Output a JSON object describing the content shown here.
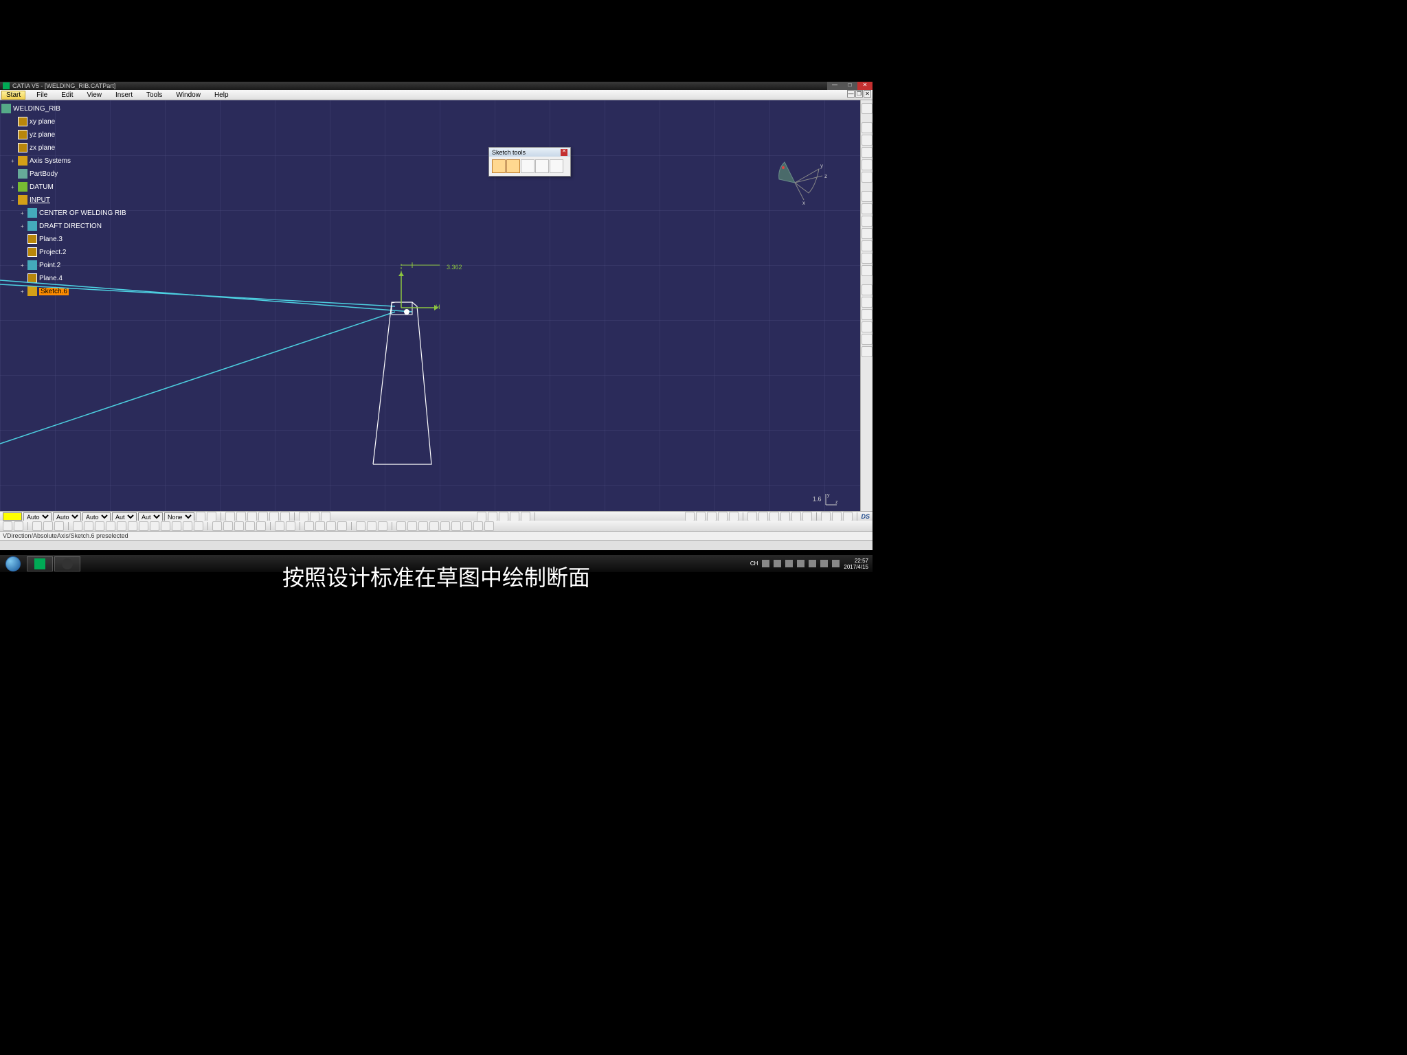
{
  "titlebar": {
    "title": "CATIA V5 - [WELDING_RIB.CATPart]"
  },
  "menubar": {
    "start": "Start",
    "items": [
      "File",
      "Edit",
      "View",
      "Insert",
      "Tools",
      "Window",
      "Help"
    ]
  },
  "tree": {
    "root": "WELDING_RIB",
    "items": [
      {
        "label": "xy plane",
        "indent": 1,
        "icon": "plane"
      },
      {
        "label": "yz plane",
        "indent": 1,
        "icon": "plane"
      },
      {
        "label": "zx plane",
        "indent": 1,
        "icon": "plane"
      },
      {
        "label": "Axis Systems",
        "indent": 1,
        "icon": "geo",
        "exp": "+"
      },
      {
        "label": "PartBody",
        "indent": 1,
        "icon": "part",
        "exp": ""
      },
      {
        "label": "DATUM",
        "indent": 1,
        "icon": "datum",
        "exp": "+"
      },
      {
        "label": "INPUT",
        "indent": 1,
        "icon": "input",
        "exp": "−",
        "underline": true
      },
      {
        "label": "CENTER OF WELDING RIB",
        "indent": 2,
        "icon": "center",
        "exp": "+"
      },
      {
        "label": "DRAFT DIRECTION",
        "indent": 2,
        "icon": "dir",
        "exp": "+"
      },
      {
        "label": "Plane.3",
        "indent": 2,
        "icon": "plane"
      },
      {
        "label": "Project.2",
        "indent": 2,
        "icon": "plane"
      },
      {
        "label": "Point.2",
        "indent": 2,
        "icon": "point",
        "exp": "+"
      },
      {
        "label": "Plane.4",
        "indent": 2,
        "icon": "plane"
      },
      {
        "label": "Sketch.6",
        "indent": 2,
        "icon": "sketch",
        "exp": "+",
        "selected": true
      }
    ]
  },
  "sketch_tools": {
    "title": "Sketch tools"
  },
  "dimension": "3.362",
  "axis_label": "H",
  "scale": "1.6",
  "status": "VDirection/AbsoluteAxis/Sketch.6 preselected",
  "bottom_selects": [
    "Auto",
    "Auto",
    "Auto",
    "Aut",
    "Aut",
    "None"
  ],
  "logo": "DS",
  "taskbar": {
    "lang": "CH",
    "time": "22:57",
    "date": "2017/4/15"
  },
  "subtitle": "按照设计标准在草图中绘制断面",
  "compass_axes": {
    "x": "x",
    "y": "y",
    "z": "z"
  }
}
